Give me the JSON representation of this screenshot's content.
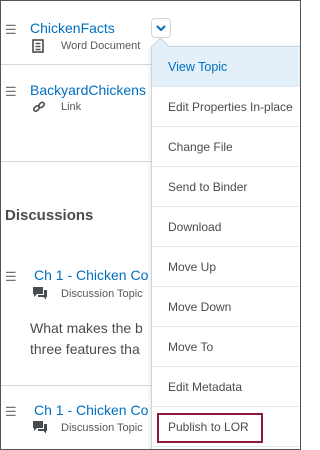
{
  "items": [
    {
      "title": "ChickenFacts",
      "type": "Word Document",
      "type_icon": "document-icon"
    },
    {
      "title": "BackyardChickens",
      "type": "Link",
      "type_icon": "link-icon"
    }
  ],
  "section_title": "Discussions",
  "discussions": [
    {
      "title": "Ch 1 - Chicken Co",
      "type": "Discussion Topic",
      "type_icon": "discussion-icon",
      "description_lines": [
        "What makes the b",
        "three features tha"
      ]
    },
    {
      "title": "Ch 1 - Chicken Co",
      "type": "Discussion Topic",
      "type_icon": "discussion-icon"
    }
  ],
  "dropdown_icon": "chevron-down-icon",
  "menu": {
    "items": [
      "View Topic",
      "Edit Properties In-place",
      "Change File",
      "Send to Binder",
      "Download",
      "Move Up",
      "Move Down",
      "Move To",
      "Edit Metadata",
      "Publish to LOR"
    ],
    "active_index": 0,
    "highlight_index": 9
  },
  "colors": {
    "link": "#006fbf",
    "highlight_border": "#8b1a3c",
    "menu_active_bg": "#e3f0fa"
  }
}
